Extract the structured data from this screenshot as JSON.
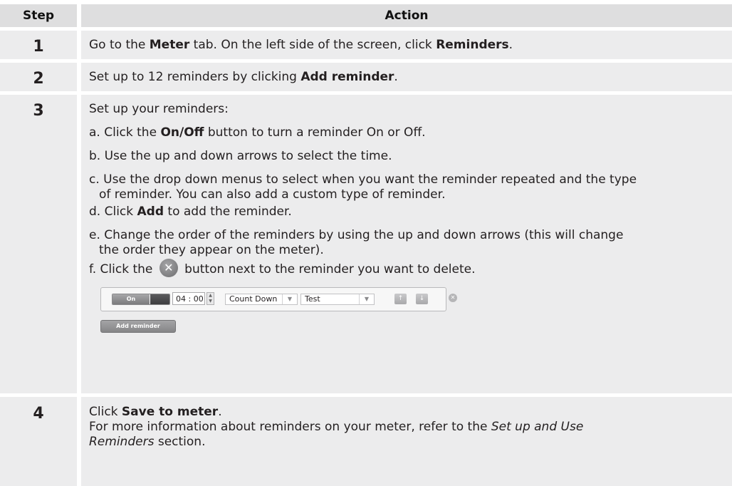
{
  "header": {
    "step": "Step",
    "action": "Action"
  },
  "rows": [
    {
      "step": "1",
      "parts": [
        "Go to the ",
        "Meter",
        " tab. On the left side of the screen, click ",
        "Reminders",
        "."
      ]
    },
    {
      "step": "2",
      "parts": [
        "Set up to 12 reminders by clicking ",
        "Add reminder",
        "."
      ]
    },
    {
      "step": "3",
      "intro": "Set up your reminders:",
      "a": [
        "a. Click the ",
        "On/Off",
        " button to turn a reminder On or Off."
      ],
      "b": "b. Use the up and down arrows to select the time.",
      "c1": "c. Use the drop down menus to select when you want the reminder repeated and the type",
      "c2": "of reminder. You can also add a custom type of reminder.",
      "d": [
        "d. Click ",
        "Add",
        " to add the reminder."
      ],
      "e1": "e. Change the order of the reminders by using the up and down arrows (this will change",
      "e2": "the order they appear on the meter).",
      "f": [
        "f. Click the ",
        " button next to the reminder you want to delete."
      ],
      "widget": {
        "toggle_label": "On",
        "time_value": "04 : 00",
        "repeat_value": "Count Down",
        "type_value": "Test",
        "add_button": "Add reminder"
      }
    },
    {
      "step": "4",
      "line1": [
        "Click ",
        "Save to meter",
        "."
      ],
      "line2": "For more information about reminders on your meter, refer to the ",
      "line2_italic": "Set up and Use",
      "line3_italic": "Reminders",
      "line3": " section."
    }
  ],
  "icons": {
    "delete": "close-circle-icon",
    "dropdown": "triangle-down-icon",
    "up": "arrow-up-icon",
    "down": "arrow-down-icon"
  },
  "colors": {
    "header_bg": "#dededf",
    "cell_bg": "#ececed",
    "text": "#231f20"
  }
}
